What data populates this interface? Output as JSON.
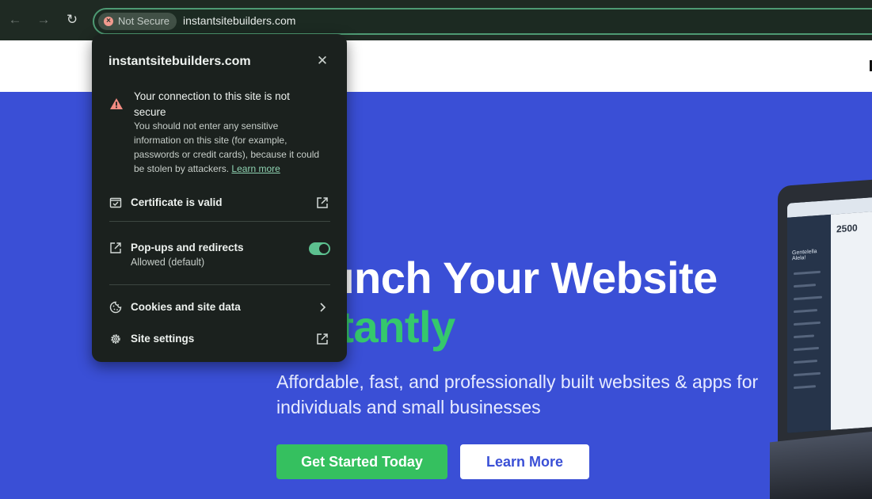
{
  "browser": {
    "nav": {
      "back": "←",
      "forward": "→",
      "reload": "↻"
    },
    "security_chip": {
      "label": "Not Secure",
      "icon": "x-circle-icon",
      "icon_glyph": "×",
      "color": "#f29b8f"
    },
    "url": "instantsitebuilders.com"
  },
  "popup": {
    "title": "instantsitebuilders.com",
    "close_glyph": "✕",
    "warning": {
      "heading": "Your connection to this site is not secure",
      "body": "You should not enter any sensitive information on this site (for example, passwords or credit cards), because it could be stolen by attackers.",
      "link": "Learn more",
      "icon": "warning-triangle-icon",
      "color": "#f28b82"
    },
    "certificate": {
      "label": "Certificate is valid",
      "icon": "certificate-icon",
      "action_icon": "external-link-icon"
    },
    "popups": {
      "label": "Pop-ups and redirects",
      "sub": "Allowed (default)",
      "icon": "external-link-icon",
      "toggle_on": true
    },
    "cookies": {
      "label": "Cookies and site data",
      "icon": "cookie-icon",
      "action_icon": "chevron-right-icon"
    },
    "site_settings": {
      "label": "Site settings",
      "icon": "gear-icon",
      "action_icon": "external-link-icon"
    }
  },
  "hero": {
    "title_line1": "Launch Your Website",
    "title_line2": "Instantly",
    "subtitle": "Affordable, fast, and professionally built websites & apps for individuals and small businesses",
    "primary_button": "Get Started Today",
    "secondary_button": "Learn More",
    "laptop_app_name": "Gentelella Alela!",
    "laptop_stat": "2500"
  },
  "colors": {
    "hero_bg": "#3a4fd6",
    "accent_green": "#35c86c",
    "popup_bg": "#1b211e",
    "toolbar_bg": "#1f2a23",
    "focus_ring": "#4e9a73"
  }
}
